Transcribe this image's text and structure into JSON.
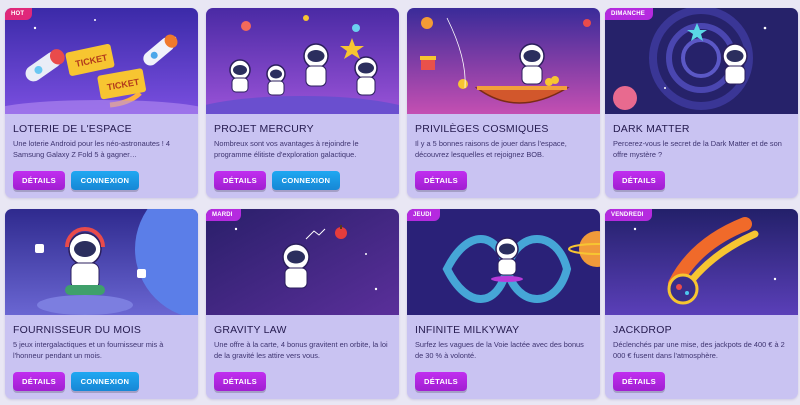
{
  "buttons": {
    "details": "DÉTAILS",
    "connect": "CONNEXION"
  },
  "cards": [
    {
      "badge": "HOT",
      "title": "LOTERIE DE L'ESPACE",
      "desc": "Une loterie Android pour les néo-astronautes ! 4 Samsung Galaxy Z Fold 5 à gagner…",
      "has_connect": true,
      "art": "rocket-tickets"
    },
    {
      "badge": "",
      "title": "PROJET MERCURY",
      "desc": "Nombreux sont vos avantages à rejoindre le programme élitiste d'exploration galactique.",
      "has_connect": true,
      "art": "astronauts-group"
    },
    {
      "badge": "",
      "title": "PRIVILÈGES COSMIQUES",
      "desc": "Il y a 5 bonnes raisons de jouer dans l'espace, découvrez lesquelles et rejoignez BOB.",
      "has_connect": false,
      "art": "astronaut-boat"
    },
    {
      "badge": "DIMANCHE",
      "title": "DARK MATTER",
      "desc": "Percerez-vous le secret de la Dark Matter et de son offre mystère ?",
      "has_connect": false,
      "art": "astronaut-vortex"
    },
    {
      "badge": "",
      "title": "FOURNISSEUR DU MOIS",
      "desc": "5 jeux intergalactiques et un fournisseur mis à l'honneur pendant un mois.",
      "has_connect": true,
      "art": "astronaut-gamer"
    },
    {
      "badge": "MARDI",
      "title": "GRAVITY LAW",
      "desc": "Une offre à la carte, 4 bonus gravitent en orbite, la loi de la gravité les attire vers vous.",
      "has_connect": false,
      "art": "astronaut-apple"
    },
    {
      "badge": "JEUDI",
      "title": "INFINITE MILKYWAY",
      "desc": "Surfez les vagues de la Voie lactée avec des bonus de 30 % à volonté.",
      "has_connect": false,
      "art": "astronaut-infinity"
    },
    {
      "badge": "VENDREDI",
      "title": "JACKDROP",
      "desc": "Déclenchés par une mise, des jackpots de 400 € à 2 000 € fusent dans l'atmosphère.",
      "has_connect": false,
      "art": "comet"
    }
  ]
}
